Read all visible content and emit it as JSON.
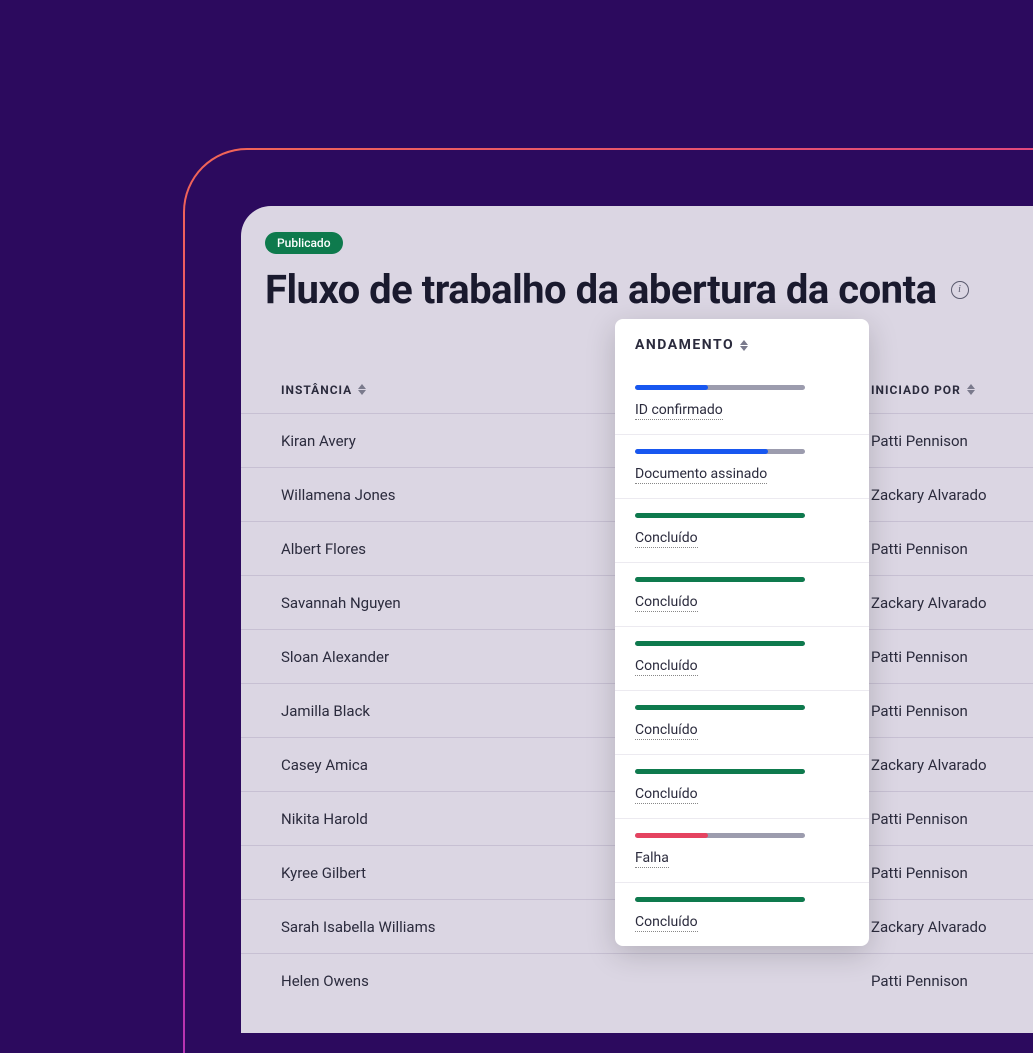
{
  "badge": "Publicado",
  "title": "Fluxo de trabalho da abertura da conta",
  "columns": {
    "instancia": "INSTÂNCIA",
    "andamento": "ANDAMENTO",
    "iniciado_por": "INICIADO POR"
  },
  "progress": [
    {
      "status": "ID confirmado",
      "percent": 43,
      "color": "blue"
    },
    {
      "status": "Documento assinado",
      "percent": 78,
      "color": "blue"
    },
    {
      "status": "Concluído",
      "percent": 100,
      "color": "green"
    },
    {
      "status": "Concluído",
      "percent": 100,
      "color": "green"
    },
    {
      "status": "Concluído",
      "percent": 100,
      "color": "green"
    },
    {
      "status": "Concluído",
      "percent": 100,
      "color": "green"
    },
    {
      "status": "Concluído",
      "percent": 100,
      "color": "green"
    },
    {
      "status": "Falha",
      "percent": 43,
      "color": "red"
    },
    {
      "status": "Concluído",
      "percent": 100,
      "color": "green"
    }
  ],
  "rows": [
    {
      "instancia": "Kiran Avery",
      "iniciado_por": "Patti Pennison"
    },
    {
      "instancia": "Willamena Jones",
      "iniciado_por": "Zackary Alvarado"
    },
    {
      "instancia": "Albert Flores",
      "iniciado_por": "Patti Pennison"
    },
    {
      "instancia": "Savannah Nguyen",
      "iniciado_por": "Zackary Alvarado"
    },
    {
      "instancia": "Sloan Alexander",
      "iniciado_por": "Patti Pennison"
    },
    {
      "instancia": "Jamilla Black",
      "iniciado_por": "Patti Pennison"
    },
    {
      "instancia": "Casey Amica",
      "iniciado_por": "Zackary Alvarado"
    },
    {
      "instancia": "Nikita Harold",
      "iniciado_por": "Patti Pennison"
    },
    {
      "instancia": "Kyree Gilbert",
      "iniciado_por": "Patti Pennison"
    },
    {
      "instancia": "Sarah Isabella Williams",
      "iniciado_por": "Zackary Alvarado"
    },
    {
      "instancia": "Helen Owens",
      "iniciado_por": "Patti Pennison"
    }
  ]
}
